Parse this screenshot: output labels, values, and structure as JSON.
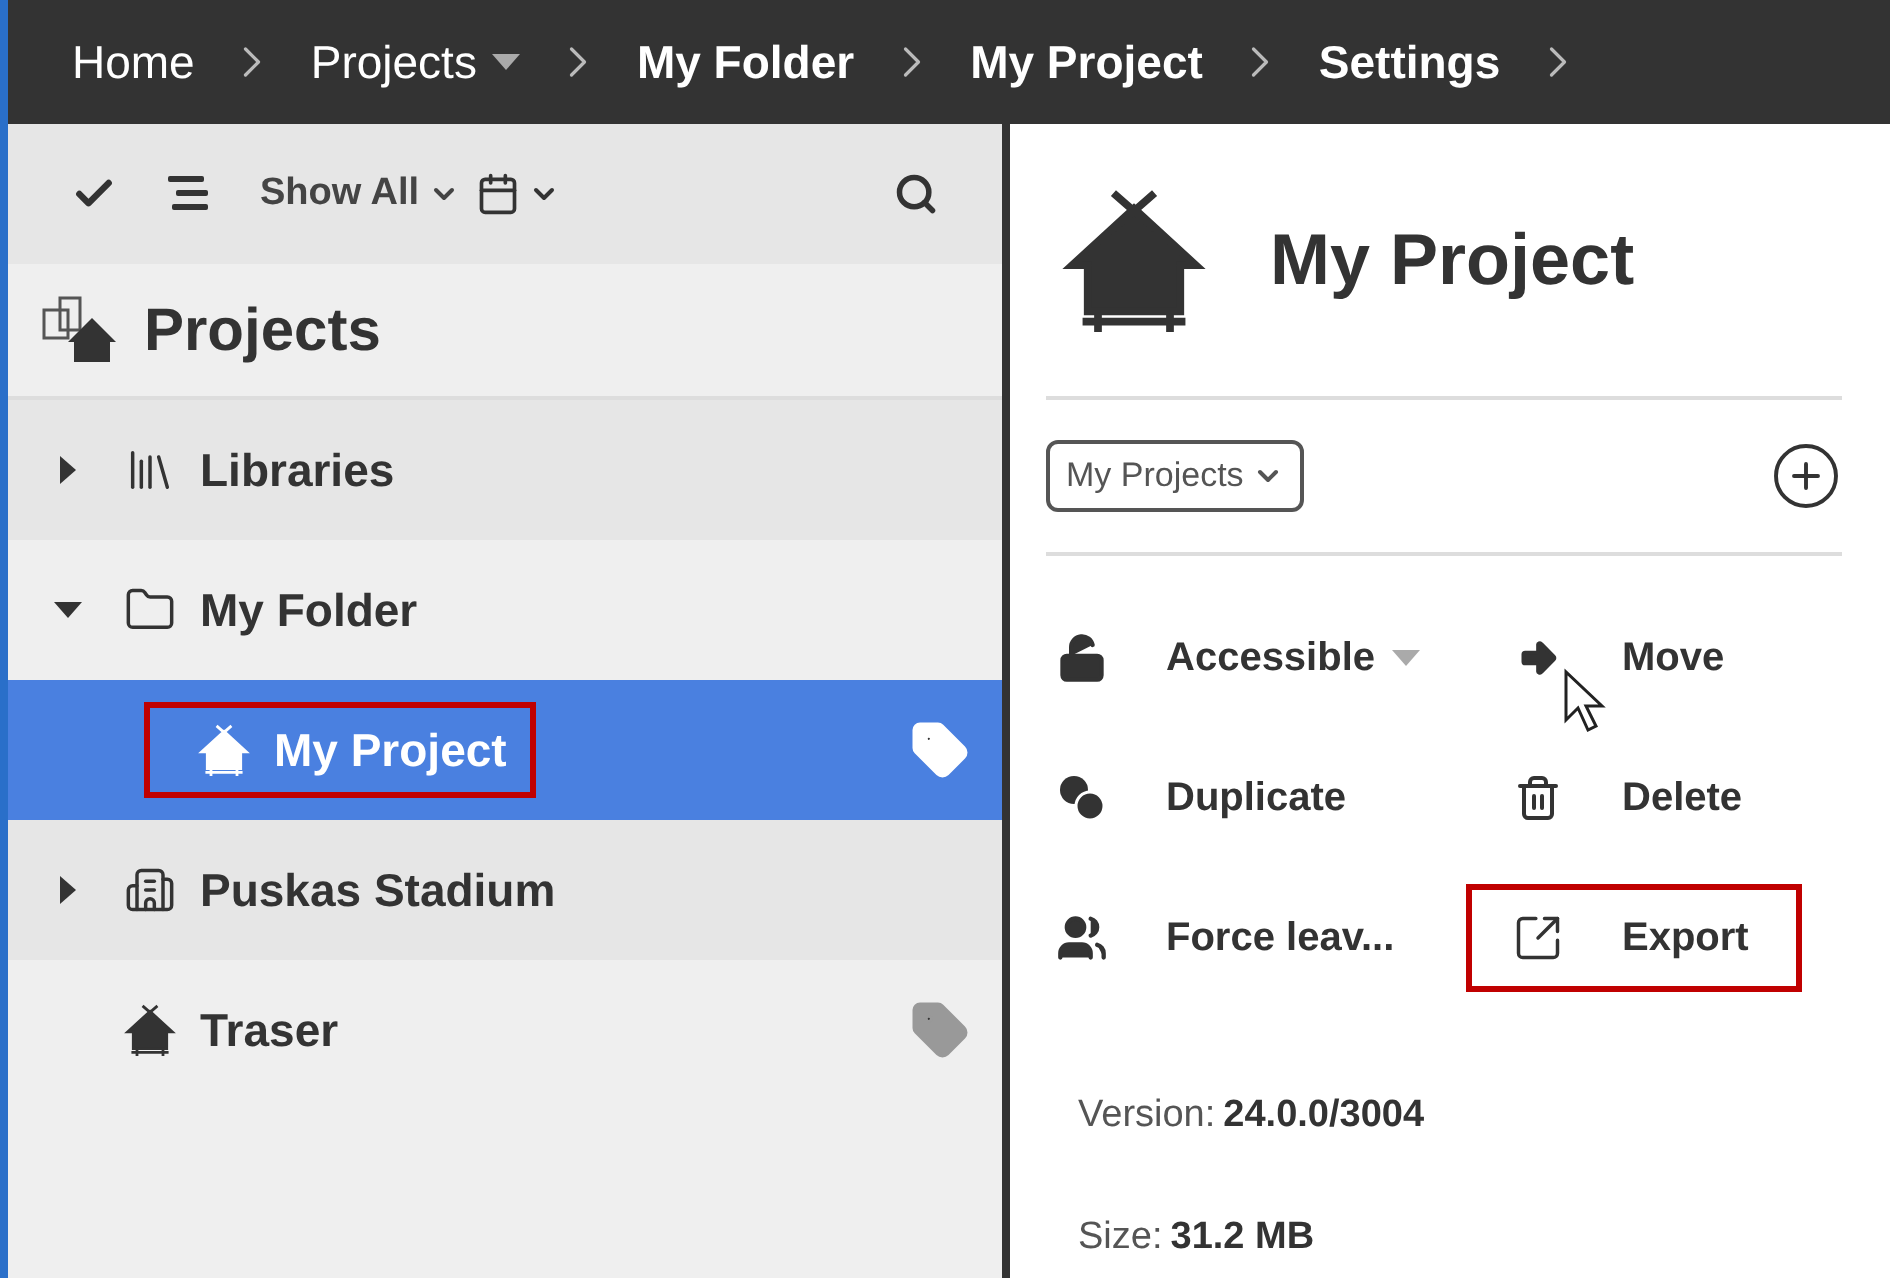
{
  "breadcrumbs": [
    {
      "label": "Home",
      "emphasized": false,
      "has_menu": false
    },
    {
      "label": "Projects",
      "emphasized": false,
      "has_menu": true
    },
    {
      "label": "My Folder",
      "emphasized": true,
      "has_menu": false
    },
    {
      "label": "My Project",
      "emphasized": true,
      "has_menu": false
    },
    {
      "label": "Settings",
      "emphasized": true,
      "has_menu": false
    }
  ],
  "toolbar": {
    "filter": "Show All"
  },
  "sidebar": {
    "title": "Projects",
    "items": [
      {
        "label": "Libraries",
        "kind": "library",
        "expanded": false,
        "selected": false,
        "highlighted": false,
        "tagged": false
      },
      {
        "label": "My Folder",
        "kind": "folder",
        "expanded": true,
        "selected": false,
        "highlighted": false,
        "tagged": false,
        "children": [
          {
            "label": "My Project",
            "kind": "project",
            "selected": true,
            "highlighted": true,
            "tagged": true
          }
        ]
      },
      {
        "label": "Puskas Stadium",
        "kind": "building",
        "expanded": false,
        "selected": false,
        "highlighted": false,
        "tagged": false
      },
      {
        "label": "Traser",
        "kind": "project",
        "selected": false,
        "highlighted": false,
        "tagged": true
      }
    ]
  },
  "detail": {
    "title": "My Project",
    "group_select": "My Projects",
    "actions": [
      {
        "label": "Accessible",
        "kind": "lock",
        "has_menu": true,
        "highlighted": false
      },
      {
        "label": "Move",
        "kind": "move",
        "has_menu": false,
        "highlighted": false
      },
      {
        "label": "Duplicate",
        "kind": "duplicate",
        "has_menu": false,
        "highlighted": false
      },
      {
        "label": "Delete",
        "kind": "delete",
        "has_menu": false,
        "highlighted": false
      },
      {
        "label": "Force leav...",
        "kind": "users",
        "has_menu": false,
        "highlighted": false
      },
      {
        "label": "Export",
        "kind": "export",
        "has_menu": false,
        "highlighted": true
      }
    ],
    "info": [
      {
        "label": "Version:",
        "value": "24.0.0/3004"
      },
      {
        "label": "Size:",
        "value": "31.2 MB"
      }
    ]
  }
}
